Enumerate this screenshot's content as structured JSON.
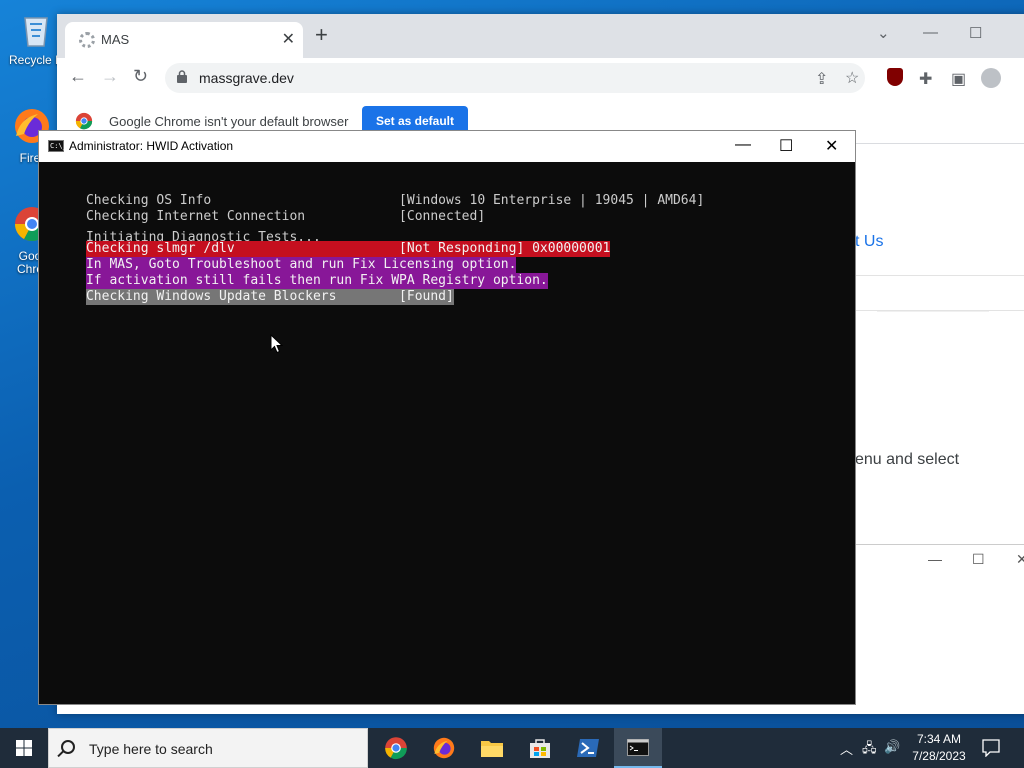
{
  "desktop": {
    "icons": [
      {
        "label": "Recycle B"
      },
      {
        "label": "Fire"
      },
      {
        "label": "Goo\nChro"
      }
    ]
  },
  "chrome": {
    "tab_title": "MAS",
    "url": "massgrave.dev",
    "infobar_text": "Google Chrome isn't your default browser",
    "set_default_label": "Set as default",
    "page_fragments": [
      "t Us",
      "enu and select"
    ]
  },
  "console": {
    "title": "Administrator:  HWID Activation",
    "icon_text": "C:\\_",
    "lines": [
      {
        "left": "Checking OS Info                        ",
        "right": "[Windows 10 Enterprise | 19045 | AMD64]",
        "style": "none"
      },
      {
        "left": "Checking Internet Connection            ",
        "right": "[Connected]",
        "style": "none"
      },
      {
        "left": "Initiating Diagnostic Tests...",
        "right": "",
        "style": "none"
      },
      {
        "left": "Checking slmgr /dlv                     ",
        "right": "[Not Responding] 0x00000001",
        "style": "red"
      },
      {
        "left": "In MAS, Goto Troubleshoot and run Fix Licensing option.",
        "right": "",
        "style": "purple"
      },
      {
        "left": "If activation still fails then run Fix WPA Registry option.",
        "right": "",
        "style": "purple"
      },
      {
        "left": "Checking Windows Update Blockers        ",
        "right": "[Found]",
        "style": "gray"
      }
    ]
  },
  "taskbar": {
    "search_placeholder": "Type here to search",
    "time": "7:34 AM",
    "date": "7/28/2023"
  },
  "colors": {
    "console_bg": "#0c0c0c",
    "hl_red": "#c50f1f",
    "hl_purple": "#881798",
    "hl_gray": "#767676",
    "chrome_blue": "#1a73e8"
  }
}
